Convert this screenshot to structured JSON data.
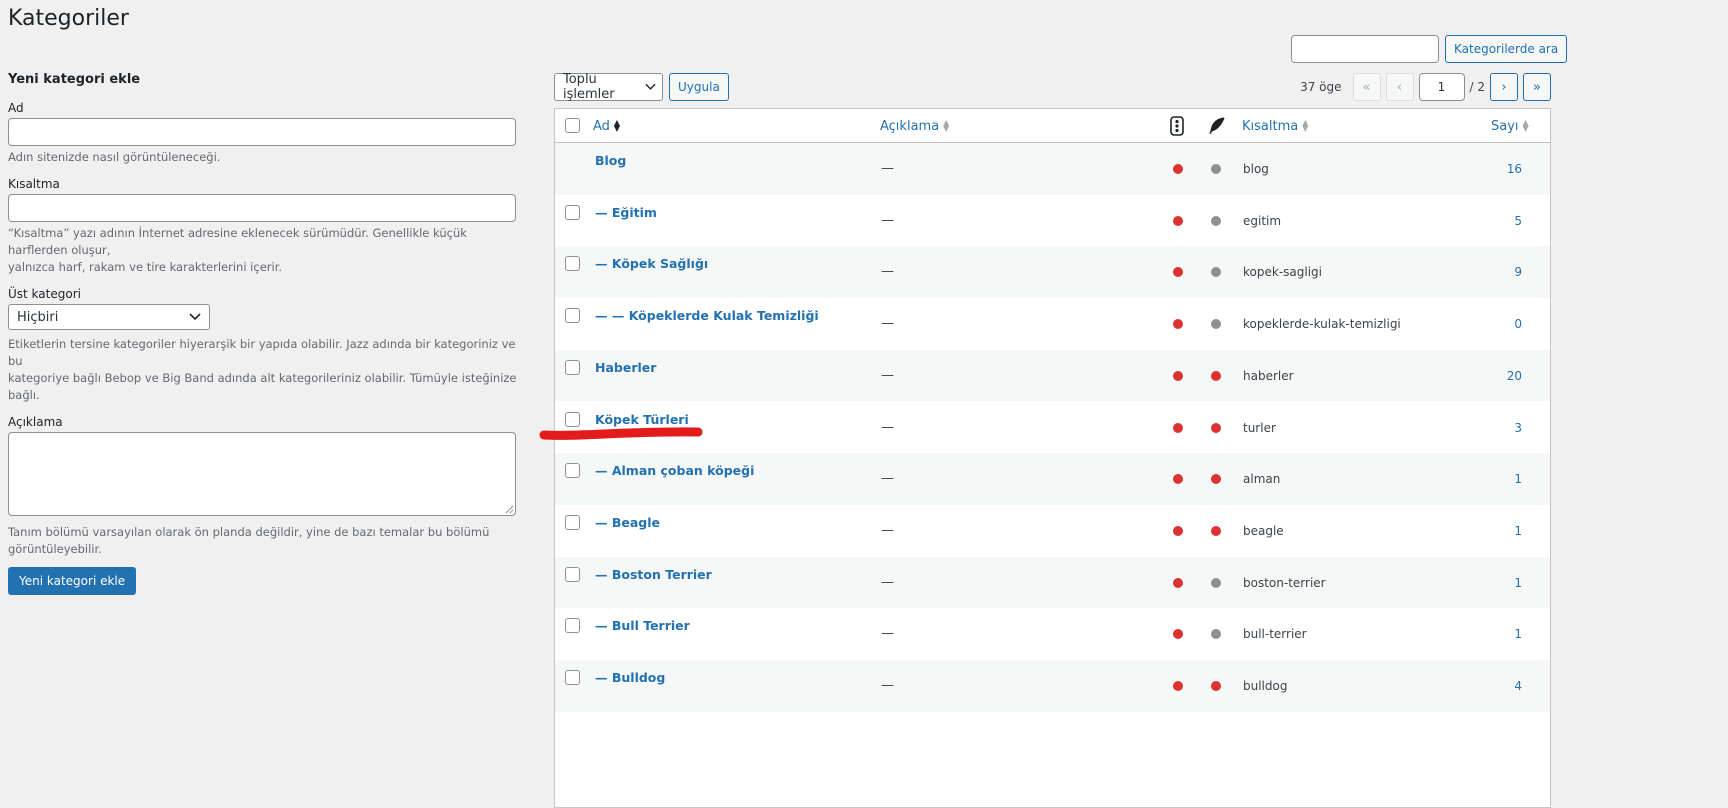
{
  "page": {
    "title": "Kategoriler"
  },
  "search": {
    "button_label": "Kategorilerde ara",
    "value": ""
  },
  "form": {
    "heading": "Yeni kategori ekle",
    "name": {
      "label": "Ad",
      "help": "Adın sitenizde nasıl görüntüleneceği."
    },
    "slug": {
      "label": "Kısaltma",
      "help_line1": "“Kısaltma” yazı adının İnternet adresine eklenecek sürümüdür. Genellikle küçük harflerden oluşur,",
      "help_line2": "yalnızca harf, rakam ve tire karakterlerini içerir."
    },
    "parent": {
      "label": "Üst kategori",
      "selected": "Hiçbiri",
      "help_line1": "Etiketlerin tersine kategoriler hiyerarşik bir yapıda olabilir. Jazz adında bir kategoriniz ve bu",
      "help_line2": "kategoriye bağlı Bebop ve Big Band adında alt kategorileriniz olabilir. Tümüyle isteğinize bağlı."
    },
    "description": {
      "label": "Açıklama",
      "help_line1": "Tanım bölümü varsayılan olarak ön planda değildir, yine de bazı temalar bu bölümü",
      "help_line2": "görüntüleyebilir."
    },
    "submit_label": "Yeni kategori ekle"
  },
  "tablenav": {
    "bulk_selected": "Toplu işlemler",
    "apply_label": "Uygula",
    "item_count": "37 öge",
    "current_page": "1",
    "total_pages": "/ 2",
    "first": "«",
    "prev": "‹",
    "next": "›",
    "last": "»"
  },
  "columns": {
    "name": "Ad",
    "description": "Açıklama",
    "slug": "Kısaltma",
    "count": "Sayı",
    "status_icon_1": "traffic-light-icon",
    "status_icon_2": "feather-icon"
  },
  "colors": {
    "red": "#dc3232",
    "gray": "#8c8f94",
    "link": "#2271b1",
    "scribble": "#e31b1b"
  },
  "rows": [
    {
      "name": "Blog",
      "desc": "—",
      "dot1": "red",
      "dot2": "gray",
      "slug": "blog",
      "count": "16",
      "checkbox": false
    },
    {
      "name": "— Eğitim",
      "desc": "—",
      "dot1": "red",
      "dot2": "gray",
      "slug": "egitim",
      "count": "5",
      "checkbox": true
    },
    {
      "name": "— Köpek Sağlığı",
      "desc": "—",
      "dot1": "red",
      "dot2": "gray",
      "slug": "kopek-sagligi",
      "count": "9",
      "checkbox": true
    },
    {
      "name": "— — Köpeklerde Kulak Temizliği",
      "desc": "—",
      "dot1": "red",
      "dot2": "gray",
      "slug": "kopeklerde-kulak-temizligi",
      "count": "0",
      "checkbox": true
    },
    {
      "name": "Haberler",
      "desc": "—",
      "dot1": "red",
      "dot2": "red",
      "slug": "haberler",
      "count": "20",
      "checkbox": true
    },
    {
      "name": "Köpek Türleri",
      "desc": "—",
      "dot1": "red",
      "dot2": "red",
      "slug": "turler",
      "count": "3",
      "checkbox": true
    },
    {
      "name": "— Alman çoban köpeği",
      "desc": "—",
      "dot1": "red",
      "dot2": "red",
      "slug": "alman",
      "count": "1",
      "checkbox": true
    },
    {
      "name": "— Beagle",
      "desc": "—",
      "dot1": "red",
      "dot2": "red",
      "slug": "beagle",
      "count": "1",
      "checkbox": true
    },
    {
      "name": "— Boston Terrier",
      "desc": "—",
      "dot1": "red",
      "dot2": "gray",
      "slug": "boston-terrier",
      "count": "1",
      "checkbox": true
    },
    {
      "name": "— Bull Terrier",
      "desc": "—",
      "dot1": "red",
      "dot2": "gray",
      "slug": "bull-terrier",
      "count": "1",
      "checkbox": true
    },
    {
      "name": "— Bulldog",
      "desc": "—",
      "dot1": "red",
      "dot2": "red",
      "slug": "bulldog",
      "count": "4",
      "checkbox": true
    }
  ]
}
